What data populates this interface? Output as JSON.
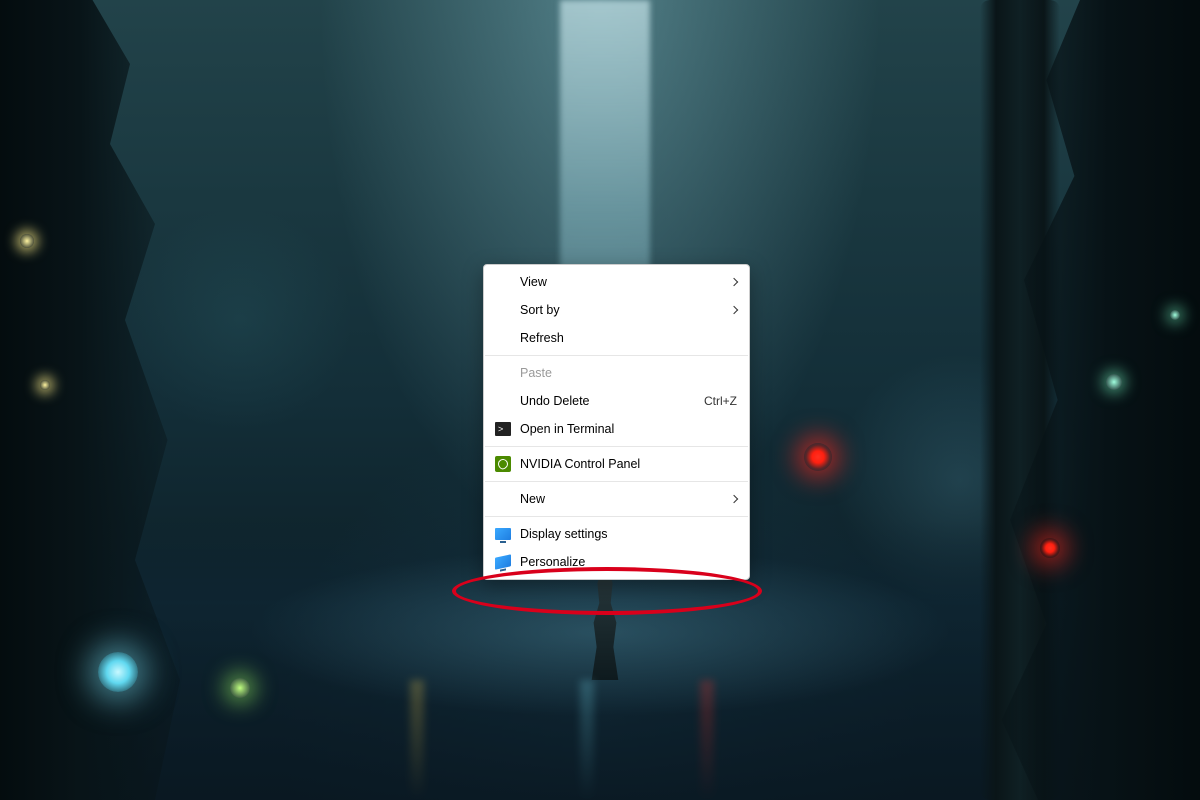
{
  "context_menu": {
    "items": {
      "view": {
        "label": "View",
        "has_submenu": true
      },
      "sort_by": {
        "label": "Sort by",
        "has_submenu": true
      },
      "refresh": {
        "label": "Refresh"
      },
      "paste": {
        "label": "Paste",
        "disabled": true
      },
      "undo_delete": {
        "label": "Undo Delete",
        "shortcut": "Ctrl+Z"
      },
      "open_terminal": {
        "label": "Open in Terminal",
        "icon": "terminal-icon"
      },
      "nvidia": {
        "label": "NVIDIA Control Panel",
        "icon": "nvidia-icon"
      },
      "new": {
        "label": "New",
        "has_submenu": true
      },
      "display_settings": {
        "label": "Display settings",
        "icon": "monitor-icon"
      },
      "personalize": {
        "label": "Personalize",
        "icon": "monitor-icon"
      }
    }
  },
  "annotation": {
    "highlighted_item": "personalize",
    "color": "#d9001b"
  }
}
